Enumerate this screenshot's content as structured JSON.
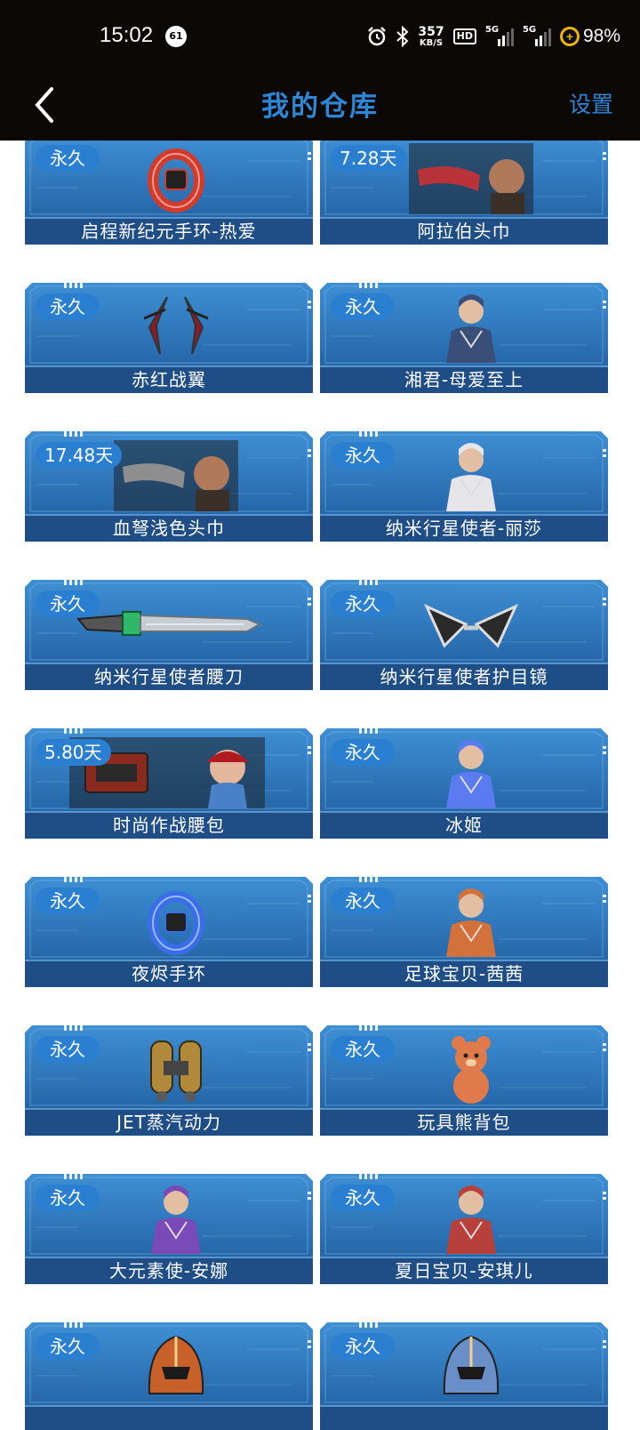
{
  "status_bar": {
    "time": "15:02",
    "notification_count": "61",
    "net_speed_value": "357",
    "net_speed_unit": "KB/S",
    "hd_label": "HD",
    "sim1_label": "5G",
    "sim2_label": "5G",
    "battery": "98%"
  },
  "header": {
    "title": "我的仓库",
    "settings_label": "设置"
  },
  "items": [
    {
      "name": "启程新纪元手环-热爱",
      "duration": "永久",
      "icon": "bracelet-icon",
      "color": "#d43a2a"
    },
    {
      "name": "阿拉伯头巾",
      "duration": "7.28天",
      "icon": "headband-icon",
      "color": "#b8333a"
    },
    {
      "name": "赤红战翼",
      "duration": "永久",
      "icon": "wings-icon",
      "color": "#8a1a2a"
    },
    {
      "name": "湘君-母爱至上",
      "duration": "永久",
      "icon": "character-icon",
      "color": "#3a4e7a"
    },
    {
      "name": "血弩浅色头巾",
      "duration": "17.48天",
      "icon": "headband-icon",
      "color": "#8e8e8e"
    },
    {
      "name": "纳米行星使者-丽莎",
      "duration": "永久",
      "icon": "character-icon",
      "color": "#e6e6ea"
    },
    {
      "name": "纳米行星使者腰刀",
      "duration": "永久",
      "icon": "knife-icon",
      "color": "#c5ccd2"
    },
    {
      "name": "纳米行星使者护目镜",
      "duration": "永久",
      "icon": "goggles-icon",
      "color": "#2a2a2a"
    },
    {
      "name": "时尚作战腰包",
      "duration": "5.80天",
      "icon": "waistbag-icon",
      "color": "#8a2a1e"
    },
    {
      "name": "冰姬",
      "duration": "永久",
      "icon": "character-icon",
      "color": "#5a7cf0"
    },
    {
      "name": "夜烬手环",
      "duration": "永久",
      "icon": "bracelet-icon",
      "color": "#3a6ee8"
    },
    {
      "name": "足球宝贝-茜茜",
      "duration": "永久",
      "icon": "character-icon",
      "color": "#d2713a"
    },
    {
      "name": "JET蒸汽动力",
      "duration": "永久",
      "icon": "jetpack-icon",
      "color": "#b08a3a"
    },
    {
      "name": "玩具熊背包",
      "duration": "永久",
      "icon": "bear-icon",
      "color": "#e07a4a"
    },
    {
      "name": "大元素使-安娜",
      "duration": "永久",
      "icon": "character-icon",
      "color": "#7a4ab8"
    },
    {
      "name": "夏日宝贝-安琪儿",
      "duration": "永久",
      "icon": "character-icon",
      "color": "#b8403a"
    },
    {
      "name": "",
      "duration": "永久",
      "icon": "helmet-icon",
      "color": "#c8602a"
    },
    {
      "name": "",
      "duration": "永久",
      "icon": "helmet-icon",
      "color": "#6a8ec8"
    }
  ]
}
